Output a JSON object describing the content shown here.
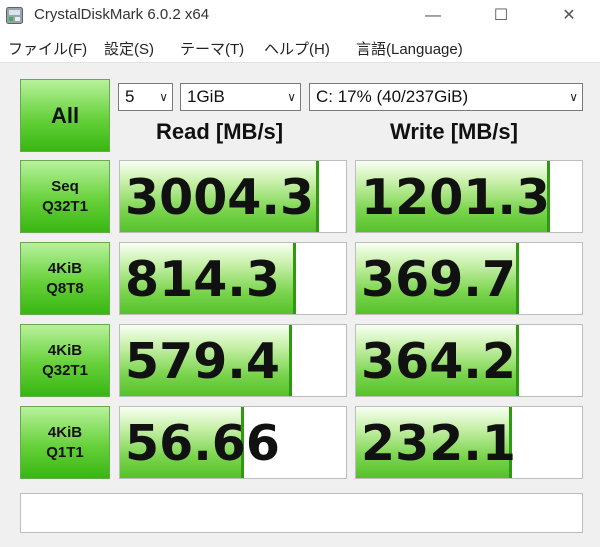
{
  "window": {
    "title": "CrystalDiskMark 6.0.2 x64",
    "minimize_glyph": "—",
    "maximize_glyph": "☐",
    "close_glyph": "✕"
  },
  "menu": {
    "items": [
      "ファイル(F)",
      "設定(S)",
      "テーマ(T)",
      "ヘルプ(H)",
      "言語(Language)"
    ]
  },
  "controls": {
    "all_label": "All",
    "test_count": "5",
    "test_size": "1GiB",
    "drive": "C: 17% (40/237GiB)",
    "chevron": "∨"
  },
  "headers": {
    "read": "Read [MB/s]",
    "write": "Write [MB/s]"
  },
  "rows": [
    {
      "line1": "Seq",
      "line2": "Q32T1",
      "read": "3004.3",
      "write": "1201.3",
      "read_fill": 0.88,
      "write_fill": 0.86
    },
    {
      "line1": "4KiB",
      "line2": "Q8T8",
      "read": "814.3",
      "write": "369.7",
      "read_fill": 0.78,
      "write_fill": 0.72
    },
    {
      "line1": "4KiB",
      "line2": "Q32T1",
      "read": "579.4",
      "write": "364.2",
      "read_fill": 0.76,
      "write_fill": 0.72
    },
    {
      "line1": "4KiB",
      "line2": "Q1T1",
      "read": "56.66",
      "write": "232.1",
      "read_fill": 0.55,
      "write_fill": 0.69
    }
  ],
  "comment": "",
  "colors": {
    "button_green": "#4fc524",
    "bar_green": "#7ad44d",
    "bar_edge": "#2f9a11"
  }
}
